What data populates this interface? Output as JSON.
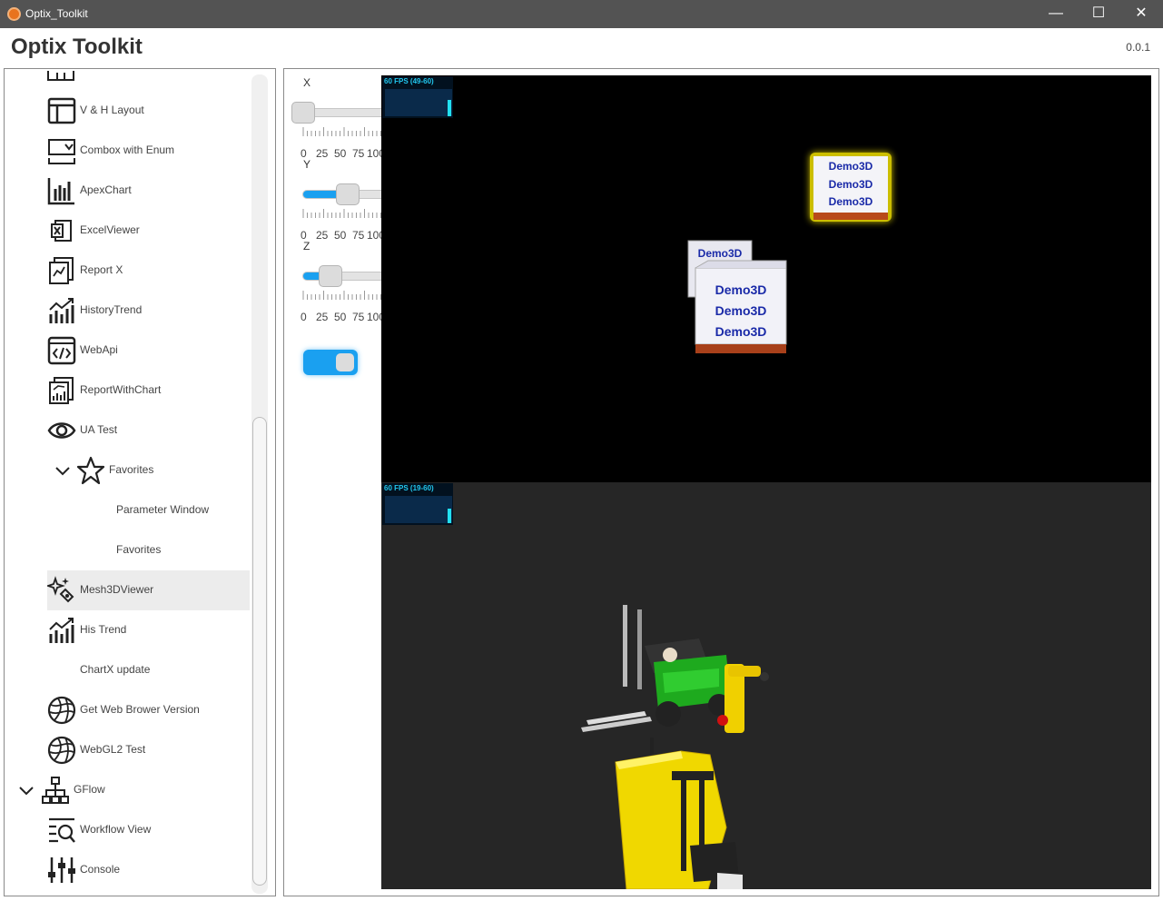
{
  "window": {
    "title": "Optix_Toolkit",
    "minimize": "—",
    "maximize": "☐",
    "close": "✕"
  },
  "header": {
    "title": "Optix Toolkit",
    "version": "0.0.1"
  },
  "sidebar": {
    "items": [
      {
        "label": "V & H Layout",
        "icon": "layout-icon"
      },
      {
        "label": "Combox with Enum",
        "icon": "combobox-icon"
      },
      {
        "label": "ApexChart",
        "icon": "bar-chart-icon"
      },
      {
        "label": "ExcelViewer",
        "icon": "excel-icon"
      },
      {
        "label": "Report X",
        "icon": "report-icon"
      },
      {
        "label": "HistoryTrend",
        "icon": "trend-icon"
      },
      {
        "label": "WebApi",
        "icon": "code-icon"
      },
      {
        "label": "ReportWithChart",
        "icon": "report-chart-icon"
      },
      {
        "label": "UA Test",
        "icon": "eye-icon"
      },
      {
        "label": "Favorites",
        "icon": "star-icon"
      },
      {
        "label": "Parameter Window"
      },
      {
        "label": "Favorites"
      },
      {
        "label": "Mesh3DViewer",
        "icon": "sparkle-icon",
        "selected": true
      },
      {
        "label": "His Trend",
        "icon": "trend-icon"
      },
      {
        "label": "ChartX update"
      },
      {
        "label": "Get Web Brower Version",
        "icon": "globe-icon"
      },
      {
        "label": "WebGL2 Test",
        "icon": "globe-icon"
      },
      {
        "label": "GFlow",
        "icon": "hierarchy-icon"
      },
      {
        "label": "Workflow View",
        "icon": "workflow-icon"
      },
      {
        "label": "Console",
        "icon": "sliders-icon"
      }
    ]
  },
  "controls": {
    "x": {
      "label": "X",
      "value": 0,
      "ticks": [
        "0",
        "25",
        "50",
        "75",
        "100"
      ]
    },
    "y": {
      "label": "Y",
      "value": 53,
      "ticks": [
        "0",
        "25",
        "50",
        "75",
        "100"
      ]
    },
    "z": {
      "label": "Z",
      "value": 33,
      "ticks": [
        "0",
        "25",
        "50",
        "75",
        "100"
      ]
    },
    "toggle": {
      "on": true
    }
  },
  "viewports": {
    "top": {
      "fps": "60 FPS (49-60)",
      "box_text": "Demo3D"
    },
    "bottom": {
      "fps": "60 FPS (19-60)"
    }
  },
  "colors": {
    "accent": "#1aa0f0",
    "fps": "#22c8f0",
    "forklift": "#f0d800",
    "robot": "#f0d000",
    "cart": "#20b020"
  }
}
